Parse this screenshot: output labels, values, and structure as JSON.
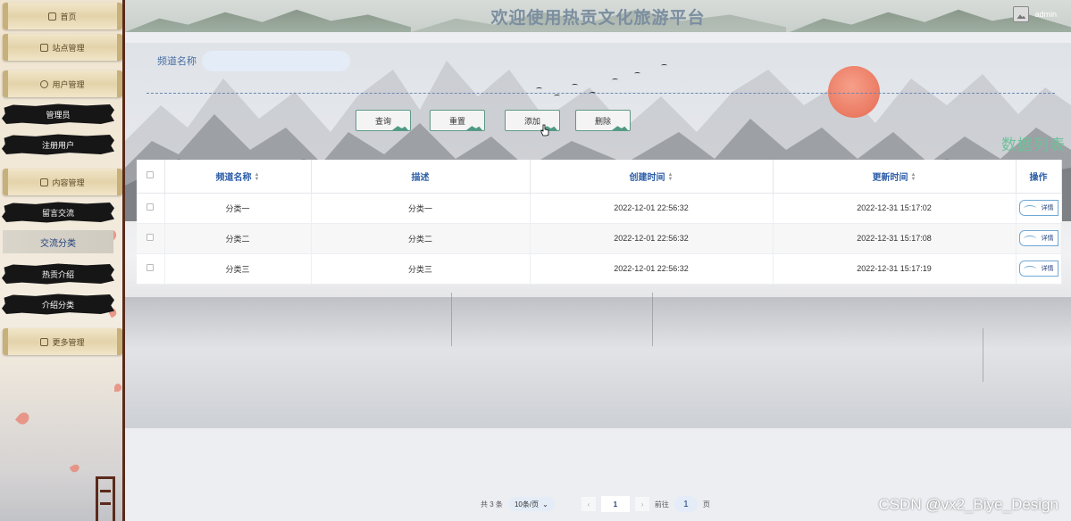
{
  "sidebar": {
    "home": "首页",
    "site": "站点管理",
    "user": "用户管理",
    "admin": "管理员",
    "registered": "注册用户",
    "content": "内容管理",
    "comments": "留言交流",
    "categories_active": "交流分类",
    "intro": "热贡介绍",
    "intro_category": "介绍分类",
    "more": "更多管理"
  },
  "header": {
    "title": "欢迎使用热贡文化旅游平台",
    "username": "admin"
  },
  "search": {
    "label": "频道名称",
    "value": "",
    "placeholder": ""
  },
  "buttons": {
    "query": "查询",
    "reset": "重置",
    "add": "添加",
    "delete": "删除"
  },
  "list_title": "数据列表",
  "table": {
    "headers": {
      "name": "频道名称",
      "desc": "描述",
      "created": "创建时间",
      "updated": "更新时间",
      "action": "操作"
    },
    "rows": [
      {
        "name": "分类一",
        "desc": "分类一",
        "created": "2022-12-01 22:56:32",
        "updated": "2022-12-31 15:17:02",
        "action": "详情"
      },
      {
        "name": "分类二",
        "desc": "分类二",
        "created": "2022-12-01 22:56:32",
        "updated": "2022-12-31 15:17:08",
        "action": "详情"
      },
      {
        "name": "分类三",
        "desc": "分类三",
        "created": "2022-12-01 22:56:32",
        "updated": "2022-12-31 15:17:19",
        "action": "详情"
      }
    ]
  },
  "pagination": {
    "total": "共 3 条",
    "page_size": "10条/页",
    "prev": "‹",
    "current": "1",
    "next": "›",
    "goto_prefix": "前往",
    "goto_value": "1",
    "goto_suffix": "页"
  },
  "watermark": "CSDN @vx2_Biye_Design",
  "colors": {
    "sidebar_border": "#5a2a1a",
    "header_title": "#7b8ea0",
    "table_header_text": "#2d5ea8",
    "list_title": "#6ec19a",
    "sun": "#e56a52",
    "button_border": "#5e9a86"
  }
}
